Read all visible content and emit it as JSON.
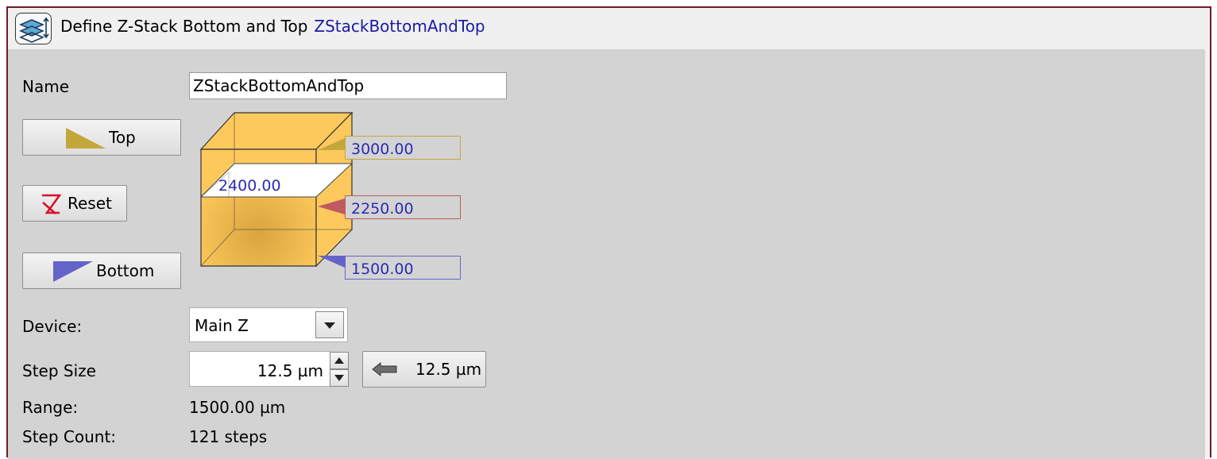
{
  "titlebar": {
    "icon": "z-stack-icon",
    "title": "Define Z-Stack Bottom and Top",
    "name": "ZStackBottomAndTop"
  },
  "form": {
    "name_label": "Name",
    "name_value": "ZStackBottomAndTop",
    "top_button": "Top",
    "reset_button": "Reset",
    "bottom_button": "Bottom",
    "device_label": "Device:",
    "device_value": "Main Z",
    "step_size_label": "Step Size",
    "step_size_value": "12.5 µm",
    "apply_step_button": "12.5 µm",
    "range_label": "Range:",
    "range_value": "1500.00 µm",
    "step_count_label": "Step Count:",
    "step_count_value": "121 steps"
  },
  "cube": {
    "current": "2400.00",
    "top": "3000.00",
    "middle": "2250.00",
    "bottom": "1500.00"
  },
  "colors": {
    "top_marker": "#c4a73a",
    "middle_marker": "#c05a5f",
    "bottom_marker": "#6464c8",
    "value_text": "#2b2bb5",
    "cube_fill": "#fdc95c",
    "reset_icon": "#d6102a",
    "title_accent": "#1a1aa6"
  },
  "icons": [
    "z-stack-icon",
    "top-triangle-icon",
    "reset-icon",
    "bottom-triangle-icon",
    "dropdown-arrow-icon",
    "spin-up-icon",
    "spin-down-icon",
    "left-arrow-icon"
  ]
}
